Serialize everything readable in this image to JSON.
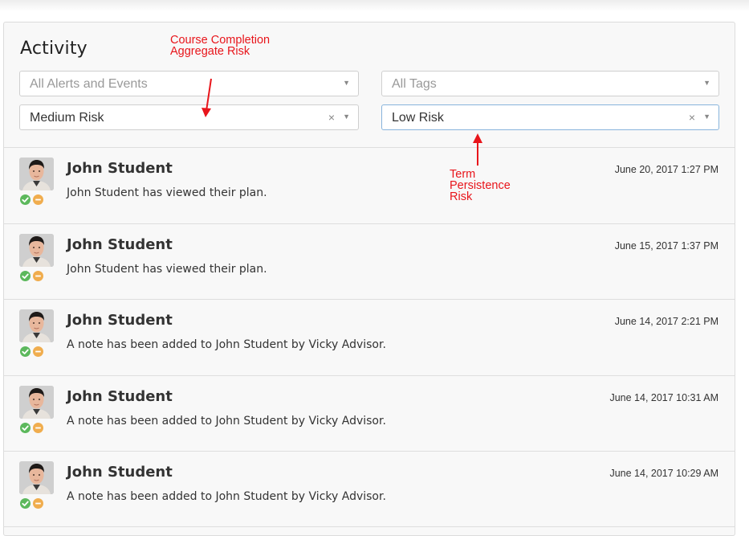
{
  "panel": {
    "title": "Activity",
    "filters": {
      "alerts": {
        "placeholder": "All Alerts and Events"
      },
      "tags": {
        "placeholder": "All Tags"
      },
      "course_risk": {
        "value": "Medium Risk",
        "clear_glyph": "×"
      },
      "term_risk": {
        "value": "Low Risk",
        "clear_glyph": "×"
      },
      "caret_glyph": "▼"
    }
  },
  "annotations": {
    "course_completion": "Course Completion\nAggregate Risk",
    "term_persistence": "Term\nPersistence\nRisk",
    "color": "#e8151b"
  },
  "activity": [
    {
      "name": "John Student",
      "text": "John Student has viewed their plan.",
      "time": "June 20, 2017 1:27 PM"
    },
    {
      "name": "John Student",
      "text": "John Student has viewed their plan.",
      "time": "June 15, 2017 1:37 PM"
    },
    {
      "name": "John Student",
      "text": "A note has been added to John Student by Vicky Advisor.",
      "time": "June 14, 2017 2:21 PM"
    },
    {
      "name": "John Student",
      "text": "A note has been added to John Student by Vicky Advisor.",
      "time": "June 14, 2017 10:31 AM"
    },
    {
      "name": "John Student",
      "text": "A note has been added to John Student by Vicky Advisor.",
      "time": "June 14, 2017 10:29 AM"
    }
  ],
  "icons": {
    "avatar": "student-avatar",
    "status_ok": "check-circle-icon",
    "status_warn": "minus-circle-icon"
  },
  "colors": {
    "ok": "#5cb85c",
    "warn": "#f0ad4e",
    "focus_border": "#88b4dc"
  }
}
